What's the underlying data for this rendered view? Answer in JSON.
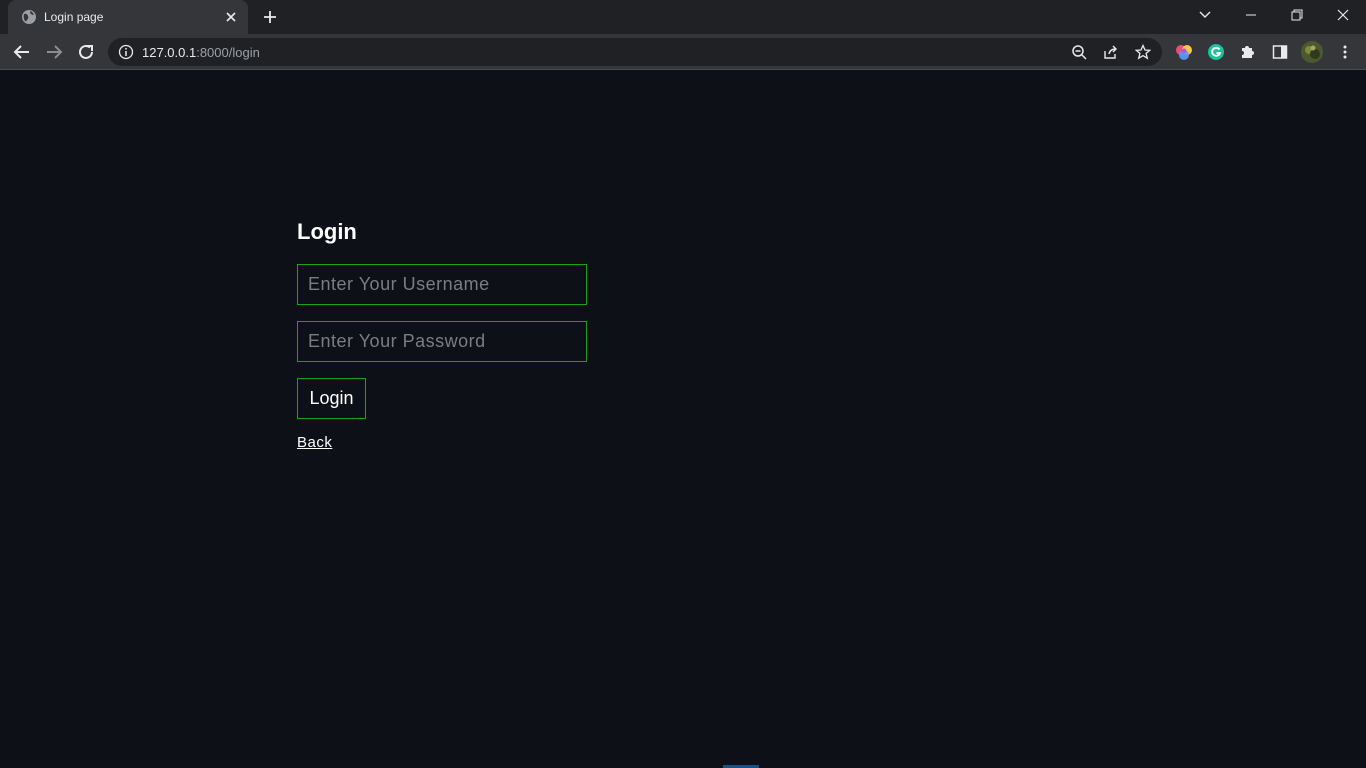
{
  "browser": {
    "tab_title": "Login page",
    "url_host": "127.0.0.1",
    "url_rest": ":8000/login"
  },
  "page": {
    "heading": "Login",
    "username_placeholder": "Enter Your Username",
    "password_placeholder": "Enter Your Password",
    "submit_label": "Login",
    "back_label": "Back"
  },
  "colors": {
    "background": "#0d1017",
    "accent_border": "#18a218"
  },
  "icons": [
    "globe-icon",
    "close-icon",
    "plus-icon",
    "chevron-down-icon",
    "minimize-icon",
    "restore-icon",
    "window-close-icon",
    "back-arrow-icon",
    "forward-arrow-icon",
    "reload-icon",
    "info-icon",
    "zoom-out-icon",
    "share-icon",
    "star-icon",
    "extension-colorful-icon",
    "grammarly-icon",
    "puzzle-icon",
    "side-panel-icon",
    "profile-avatar",
    "kebab-menu-icon"
  ]
}
